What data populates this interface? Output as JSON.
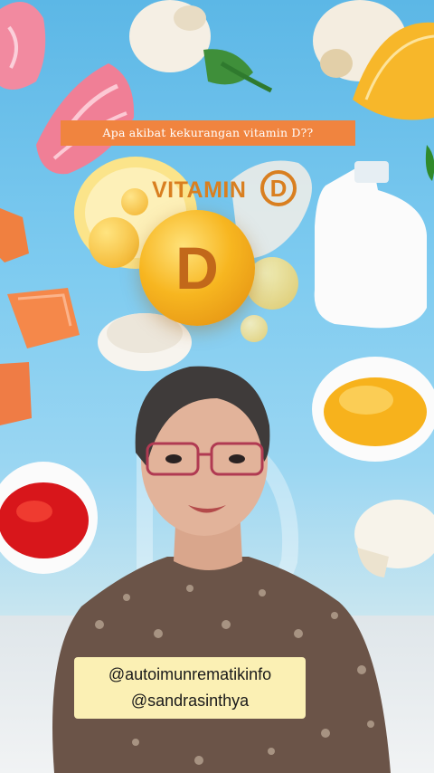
{
  "caption": {
    "text": "Apa akibat kekurangan vitamin D??"
  },
  "vitamin_logo": {
    "word": "VITAMIN",
    "letter": "D"
  },
  "big_capsule": {
    "letter": "D"
  },
  "handles": {
    "line1": "@autoimunrematikinfo",
    "line2": "@sandrasinthya"
  },
  "colors": {
    "caption_bg": "#f0843f",
    "vitamin_orange": "#d97f20",
    "capsule_gold": "#f7b620",
    "handle_bg": "#fbf0b4",
    "sky_blue": "#7ecbf0"
  }
}
